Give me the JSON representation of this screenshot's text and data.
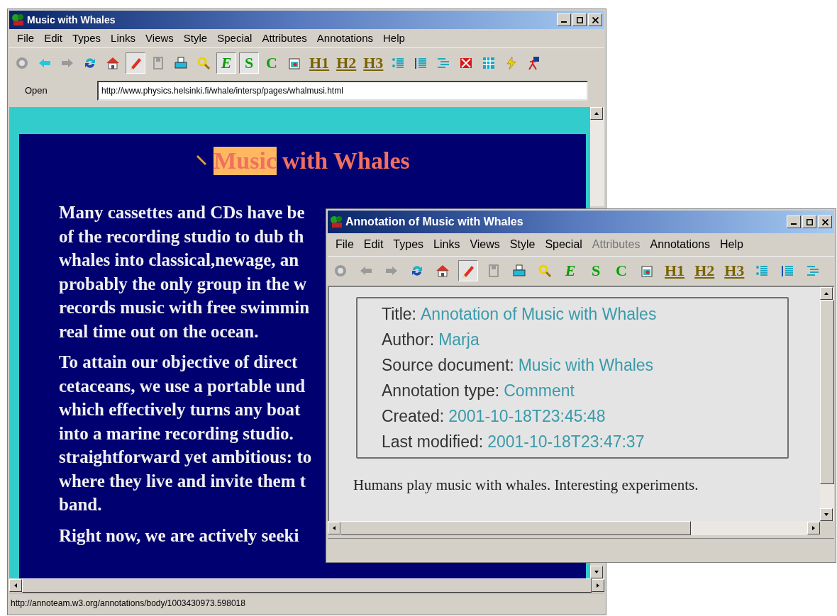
{
  "main_window": {
    "title": "Music with Whales",
    "menu": [
      {
        "label": "File",
        "disabled": false
      },
      {
        "label": "Edit",
        "disabled": false
      },
      {
        "label": "Types",
        "disabled": false
      },
      {
        "label": "Links",
        "disabled": false
      },
      {
        "label": "Views",
        "disabled": false
      },
      {
        "label": "Style",
        "disabled": false
      },
      {
        "label": "Special",
        "disabled": false
      },
      {
        "label": "Attributes",
        "disabled": false
      },
      {
        "label": "Annotations",
        "disabled": false
      },
      {
        "label": "Help",
        "disabled": false
      }
    ],
    "toolbar": [
      {
        "disabled": true,
        "pressed": false
      },
      {
        "disabled": false,
        "pressed": false
      },
      {
        "disabled": true,
        "pressed": false
      },
      {
        "disabled": false,
        "pressed": false
      },
      {
        "disabled": false,
        "pressed": false
      },
      {
        "disabled": false,
        "pressed": true
      },
      {
        "disabled": true,
        "pressed": false
      },
      {
        "disabled": false,
        "pressed": false
      },
      {
        "disabled": false,
        "pressed": false
      },
      {
        "label": "E",
        "disabled": false,
        "pressed": true
      },
      {
        "label": "S",
        "disabled": false,
        "pressed": true
      },
      {
        "label": "C",
        "disabled": false,
        "pressed": false
      },
      {
        "disabled": false,
        "pressed": false
      },
      {
        "label": "H1",
        "disabled": false,
        "pressed": false
      },
      {
        "label": "H2",
        "disabled": false,
        "pressed": false
      },
      {
        "label": "H3",
        "disabled": false,
        "pressed": false
      },
      {
        "disabled": false,
        "pressed": false
      },
      {
        "disabled": false,
        "pressed": false
      },
      {
        "disabled": false,
        "pressed": false
      },
      {
        "disabled": false,
        "pressed": false
      },
      {
        "disabled": false,
        "pressed": false
      },
      {
        "disabled": false,
        "pressed": false
      },
      {
        "disabled": false,
        "pressed": false
      }
    ],
    "address": {
      "label": "Open",
      "value": "http://www.physics.helsinki.fi/whale/intersp/pages/whalmusi.html"
    },
    "page": {
      "heading": [
        {
          "text": "Music",
          "highlighted": true
        },
        {
          "text": "with Whales",
          "highlighted": false
        }
      ],
      "paragraphs": [
        [
          "Many cassettes and CDs have be",
          "of the recording studio to dub th",
          "whales into classical,newage, an",
          "probably the only group in the w",
          "records music with free swimmin",
          "real time out on the ocean."
        ],
        [
          "To attain our objective of direct",
          "cetaceans, we use a portable und",
          "which effectively turns any boat",
          "into a marine recording studio.",
          "straightforward yet ambitious: to",
          "where they live and invite them t",
          "band."
        ],
        [
          "Right now, we are actively seeki"
        ]
      ]
    },
    "status_bar": "http://annoteam.w3.org/annotations/body/1003430973.598018"
  },
  "annotation_window": {
    "title": "Annotation of Music with Whales",
    "menu": [
      {
        "label": "File",
        "disabled": false
      },
      {
        "label": "Edit",
        "disabled": false
      },
      {
        "label": "Types",
        "disabled": false
      },
      {
        "label": "Links",
        "disabled": false
      },
      {
        "label": "Views",
        "disabled": false
      },
      {
        "label": "Style",
        "disabled": false
      },
      {
        "label": "Special",
        "disabled": false
      },
      {
        "label": "Attributes",
        "disabled": true
      },
      {
        "label": "Annotations",
        "disabled": false
      },
      {
        "label": "Help",
        "disabled": false
      }
    ],
    "toolbar": [
      {
        "disabled": true,
        "pressed": false
      },
      {
        "disabled": true,
        "pressed": false
      },
      {
        "disabled": true,
        "pressed": false
      },
      {
        "disabled": false,
        "pressed": false
      },
      {
        "disabled": false,
        "pressed": false
      },
      {
        "disabled": false,
        "pressed": true
      },
      {
        "disabled": true,
        "pressed": false
      },
      {
        "disabled": false,
        "pressed": false
      },
      {
        "disabled": false,
        "pressed": false
      },
      {
        "label": "E",
        "disabled": false,
        "pressed": false
      },
      {
        "label": "S",
        "disabled": false,
        "pressed": false
      },
      {
        "label": "C",
        "disabled": false,
        "pressed": false
      },
      {
        "disabled": false,
        "pressed": false
      },
      {
        "label": "H1",
        "disabled": false,
        "pressed": false
      },
      {
        "label": "H2",
        "disabled": false,
        "pressed": false
      },
      {
        "label": "H3",
        "disabled": false,
        "pressed": false
      },
      {
        "disabled": false,
        "pressed": false
      },
      {
        "disabled": false,
        "pressed": false
      },
      {
        "disabled": false,
        "pressed": false
      }
    ],
    "fields": [
      {
        "label": "Title:",
        "value": "Annotation of Music with Whales"
      },
      {
        "label": "Author:",
        "value": "Marja"
      },
      {
        "label": "Source document:",
        "value": "Music with Whales"
      },
      {
        "label": "Annotation type:",
        "value": "Comment"
      },
      {
        "label": "Created:",
        "value": "2001-10-18T23:45:48"
      },
      {
        "label": "Last modified:",
        "value": "2001-10-18T23:47:37"
      }
    ],
    "body": "Humans play music with whales. Interesting experiments."
  }
}
